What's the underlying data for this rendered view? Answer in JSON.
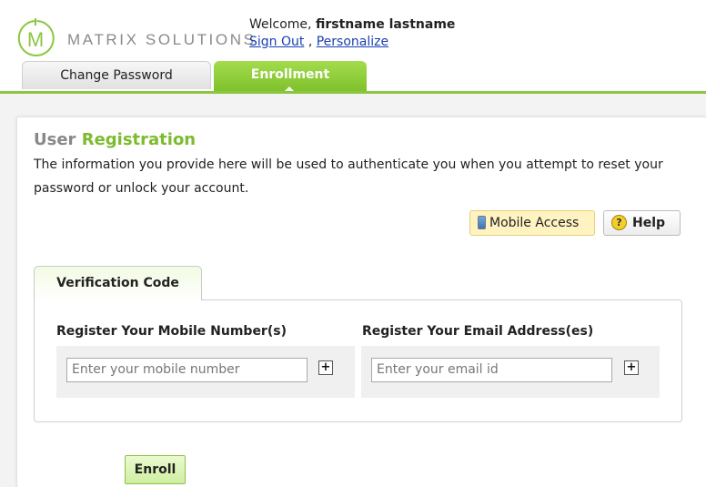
{
  "brand": {
    "name": "MATRIX SOLUTIONS",
    "logo_letter": "M",
    "accent": "#8bc63f"
  },
  "user": {
    "welcome_prefix": "Welcome,",
    "name": "firstname lastname"
  },
  "links": {
    "sign_out": "Sign Out",
    "separator": ",",
    "personalize": "Personalize"
  },
  "tabs": [
    {
      "label": "Change Password",
      "active": false
    },
    {
      "label": "Enrollment",
      "active": true
    }
  ],
  "page": {
    "title_part1": "User",
    "title_part2": "Registration",
    "description": "The information you provide here will be used to authenticate you when you attempt to reset your password or unlock your account."
  },
  "buttons": {
    "mobile_access": "Mobile Access",
    "help": "Help",
    "help_icon_glyph": "?",
    "enroll": "Enroll",
    "add_glyph": "+"
  },
  "verification": {
    "tab_label": "Verification Code",
    "mobile_label": "Register Your Mobile Number(s)",
    "mobile_placeholder": "Enter your mobile number",
    "email_label": "Register Your Email Address(es)",
    "email_placeholder": "Enter your email id"
  }
}
